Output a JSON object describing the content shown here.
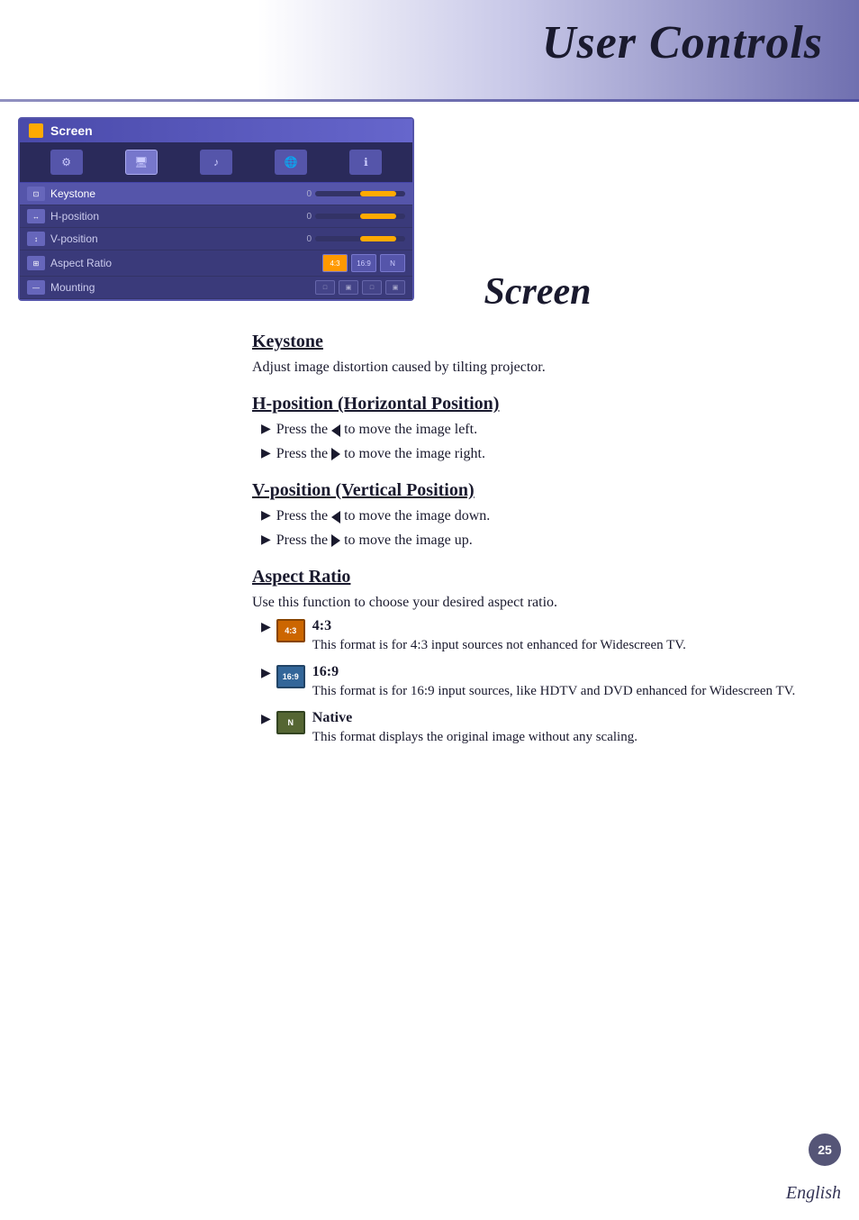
{
  "header": {
    "title": "User Controls"
  },
  "osd": {
    "title": "Screen",
    "menu_items": [
      {
        "label": "Keystone",
        "type": "slider",
        "value": "0"
      },
      {
        "label": "H-position",
        "type": "slider",
        "value": "0"
      },
      {
        "label": "V-position",
        "type": "slider",
        "value": "0"
      },
      {
        "label": "Aspect Ratio",
        "type": "aspect"
      },
      {
        "label": "Mounting",
        "type": "mounting"
      }
    ]
  },
  "section": {
    "title": "Screen",
    "subsections": [
      {
        "heading": "Keystone",
        "body": "Adjust image distortion caused by tilting projector.",
        "bullets": []
      },
      {
        "heading": "H-position (Horizontal Position)",
        "body": "",
        "bullets": [
          "Press the ◀ to move the image left.",
          "Press the ▶ to move the image right."
        ]
      },
      {
        "heading": "V-position (Vertical Position)",
        "body": "",
        "bullets": [
          "Press the ◀ to move the image down.",
          "Press the ▶ to move the image up."
        ]
      },
      {
        "heading": "Aspect Ratio",
        "body": "Use this function to choose your desired aspect ratio.",
        "bullets": []
      }
    ],
    "aspect_ratios": [
      {
        "label": "4:3",
        "icon_text": "4:3",
        "description": "This format is for 4:3 input sources not enhanced for Widescreen TV."
      },
      {
        "label": "16:9",
        "icon_text": "16:9",
        "description": "This format is for 16:9 input sources, like HDTV and DVD enhanced for Widescreen TV."
      },
      {
        "label": "Native",
        "icon_text": "N",
        "description": "This format displays the original image without any scaling."
      }
    ]
  },
  "footer": {
    "page_number": "25",
    "language": "English"
  }
}
